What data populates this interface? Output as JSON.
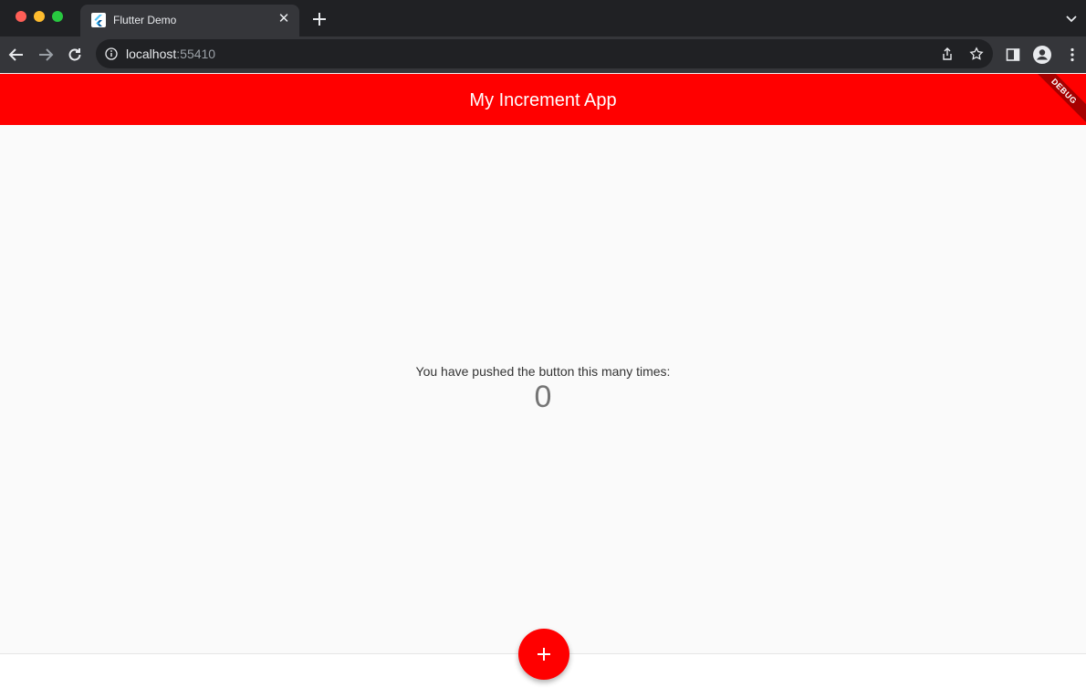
{
  "browser": {
    "tab": {
      "title": "Flutter Demo",
      "close_glyph": "✕",
      "favicon": "flutter-logo-icon"
    },
    "address": {
      "host": "localhost",
      "port": ":55410"
    },
    "icons": [
      "back-arrow-icon",
      "forward-arrow-icon",
      "reload-icon",
      "info-icon",
      "share-icon",
      "star-icon",
      "side-panel-icon",
      "profile-icon",
      "kebab-menu-icon",
      "tab-search-icon",
      "new-tab-icon"
    ]
  },
  "app": {
    "title": "My Increment App",
    "debug_banner": "DEBUG",
    "counter_label": "You have pushed the button this many times:",
    "counter_value": "0",
    "fab_icon": "plus-icon",
    "colors": {
      "primary": "#ff0000",
      "background": "#fafafa"
    }
  }
}
